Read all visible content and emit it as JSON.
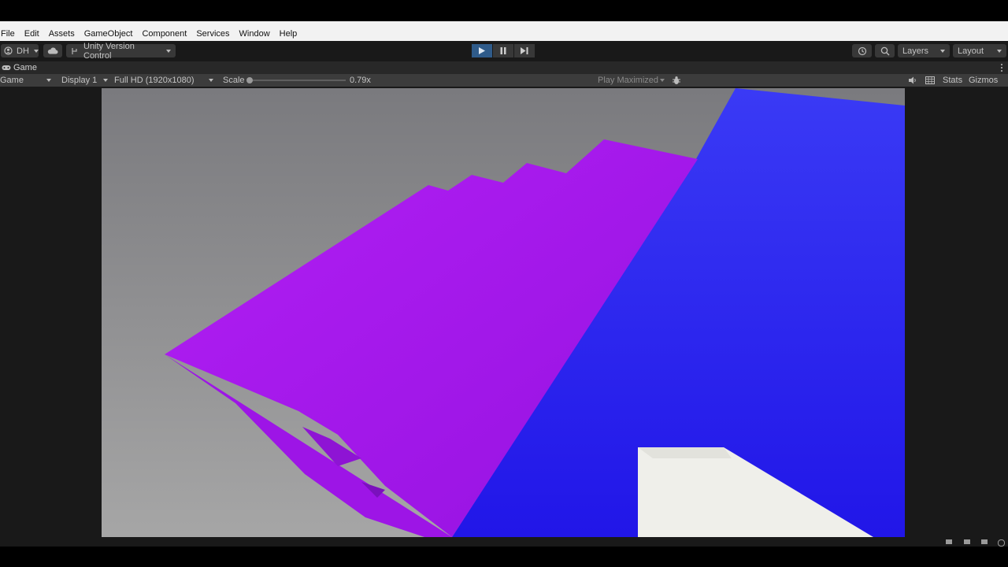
{
  "menu": [
    "File",
    "Edit",
    "Assets",
    "GameObject",
    "Component",
    "Services",
    "Window",
    "Help"
  ],
  "toolbar": {
    "account": "DH",
    "version_control": "Unity Version Control",
    "layers": "Layers",
    "layout": "Layout"
  },
  "tab": {
    "label": "Game"
  },
  "gamebar": {
    "mode": "Game",
    "display": "Display 1",
    "resolution": "Full HD (1920x1080)",
    "scale_label": "Scale",
    "scale_value": "0.79x",
    "play_maximized": "Play Maximized",
    "stats": "Stats",
    "gizmos": "Gizmos"
  },
  "scene_colors": {
    "sky_top": "#7a7a7e",
    "sky_bottom": "#a6a6a6",
    "magenta": "#a61cf0",
    "blue": "#2b22ee",
    "white_block": "#efefea"
  }
}
